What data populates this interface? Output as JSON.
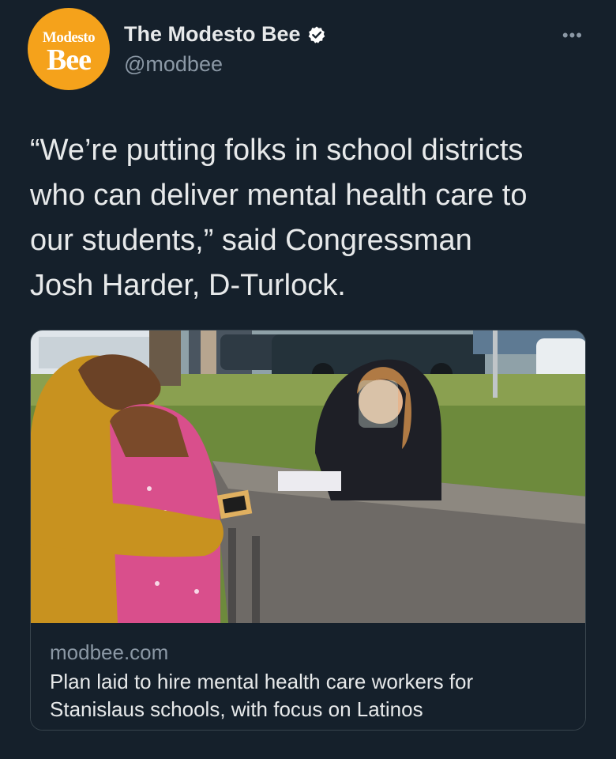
{
  "account": {
    "avatar_text_line1": "Modesto",
    "avatar_text_line2": "Bee",
    "display_name": "The Modesto Bee",
    "handle": "@modbee",
    "verified": true
  },
  "more_icon": "more-horizontal-icon",
  "more_label": "•••",
  "tweet": {
    "text": "“We’re putting folks in school districts\nwho can deliver mental health care to\nour students,” said Congressman\nJosh Harder, D-Turlock."
  },
  "link_card": {
    "domain": "modbee.com",
    "title": "Plan laid to hire mental health care workers for Stanislaus schools, with focus on Latinos"
  },
  "colors": {
    "background": "#15202b",
    "text_primary": "#e7e9ea",
    "text_secondary": "#8b98a5",
    "verified_badge": "#ffffff",
    "avatar_brand": "#f5a21b",
    "card_border": "#38444d"
  }
}
